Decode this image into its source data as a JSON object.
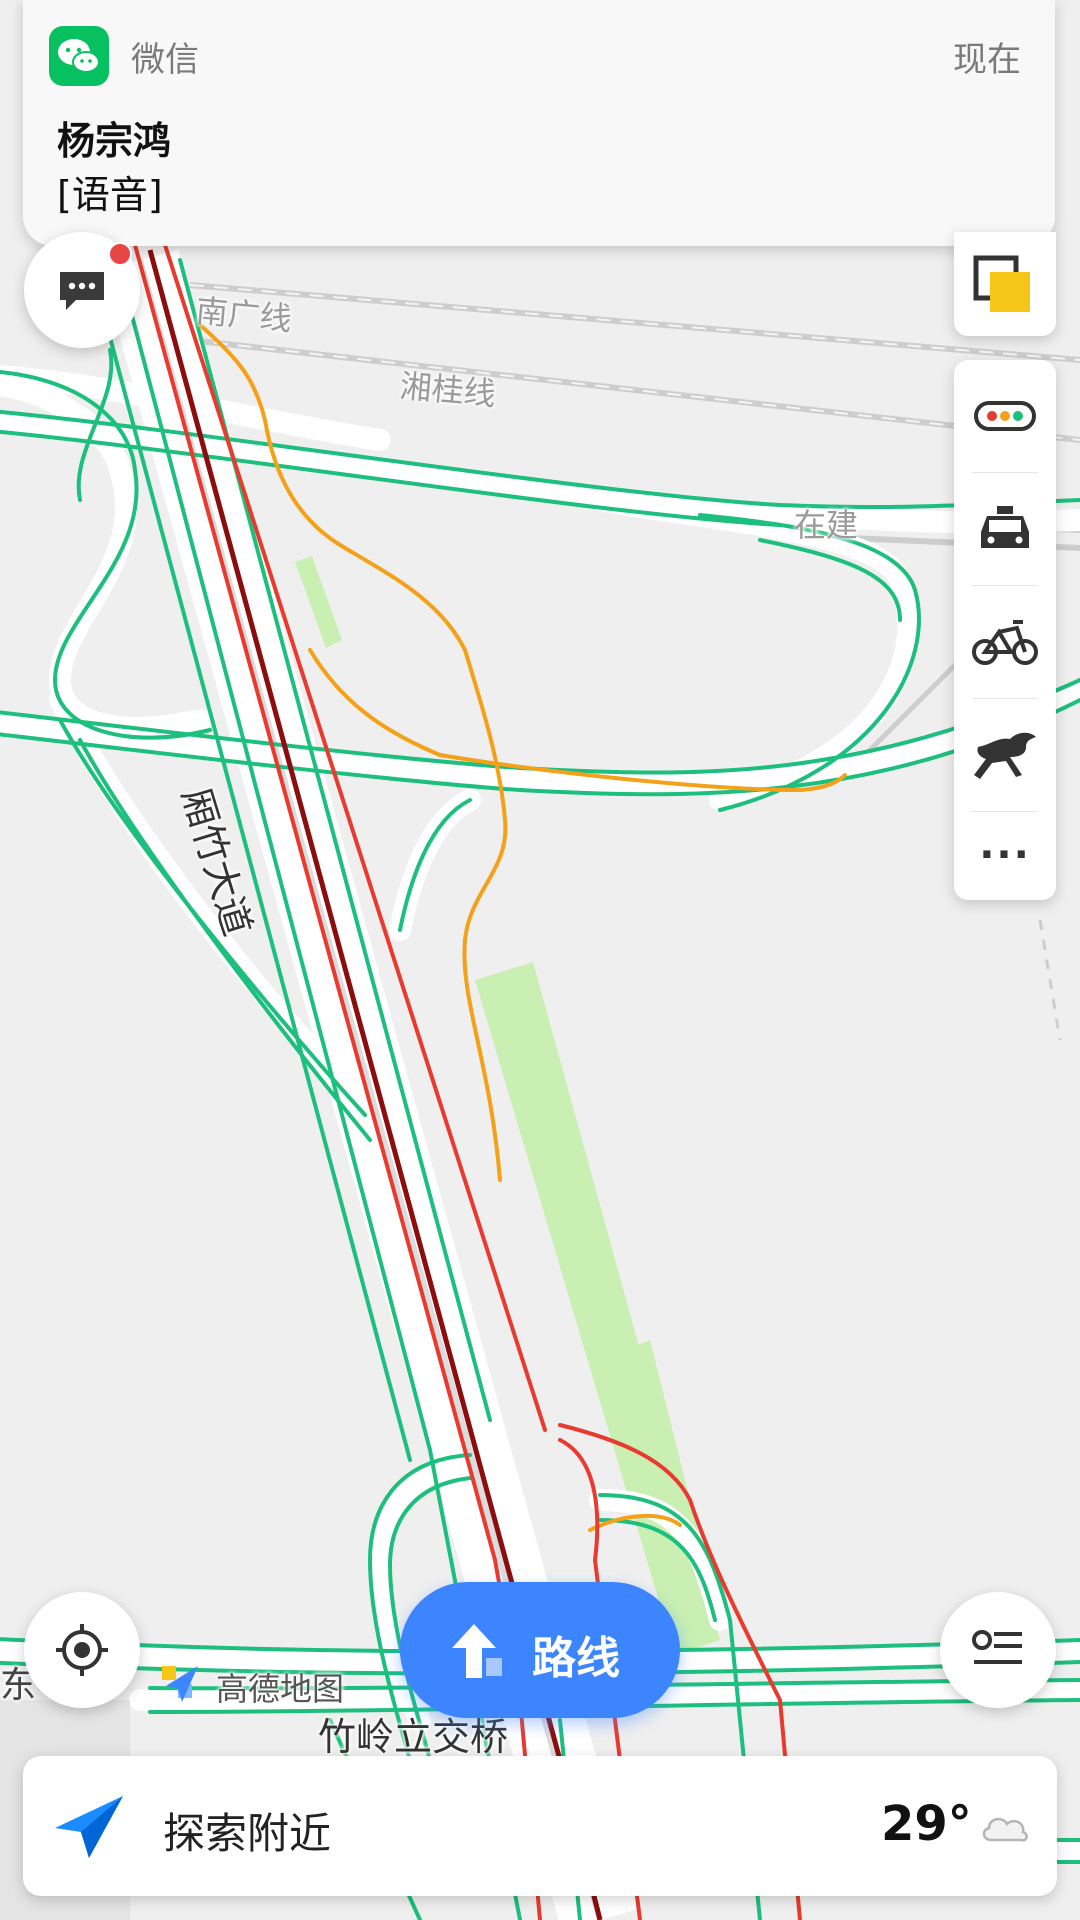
{
  "notification": {
    "app_name": "微信",
    "time": "现在",
    "sender": "杨宗鸿",
    "message": "[语音]",
    "icon": "wechat-icon"
  },
  "map_labels": {
    "railway_1": "南广线",
    "railway_2": "湘桂线",
    "construction": "在建",
    "main_road": "厢竹大道",
    "interchange": "竹岭立交桥",
    "partial_left": "东",
    "watermark": "高德地图"
  },
  "side_panel": {
    "items": [
      {
        "name": "traffic",
        "icon": "traffic-light-icon"
      },
      {
        "name": "taxi",
        "icon": "taxi-icon"
      },
      {
        "name": "bike",
        "icon": "bicycle-icon"
      },
      {
        "name": "train",
        "icon": "horse-icon"
      },
      {
        "name": "more",
        "icon": "more-icon",
        "label": "···"
      }
    ]
  },
  "route_button": {
    "label": "路线",
    "icon": "arrow-up-icon"
  },
  "bottom_bar": {
    "label": "探索附近",
    "temperature": "29°",
    "icons": [
      "navigation-arrow-icon",
      "cloud-icon"
    ]
  },
  "colors": {
    "accent": "#3d84ff",
    "traffic_green": "#1dbf7e",
    "traffic_orange": "#f4a119",
    "traffic_red": "#e83a2f",
    "traffic_darkred": "#8b0d0d",
    "park": "#c9efb3",
    "wechat": "#07c160"
  }
}
